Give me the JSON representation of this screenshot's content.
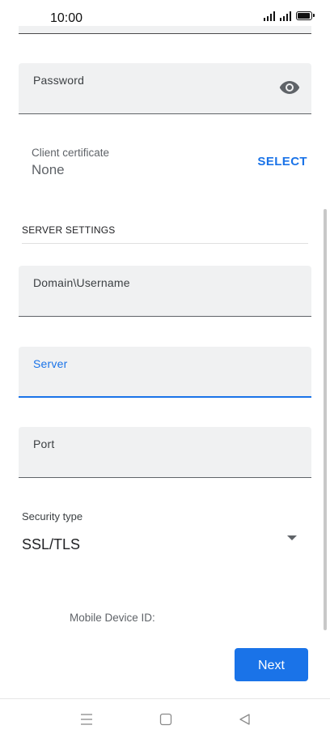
{
  "status_bar": {
    "time": "10:00",
    "icons": [
      "signal-1-icon",
      "signal-2-icon",
      "battery-icon"
    ]
  },
  "form": {
    "password": {
      "label": "Password",
      "value": "",
      "icon": "eye-icon"
    },
    "client_certificate": {
      "label": "Client certificate",
      "value": "None",
      "action_label": "SELECT"
    },
    "server_settings": {
      "header": "SERVER SETTINGS",
      "domain_username": {
        "label": "Domain\\Username",
        "value": ""
      },
      "server": {
        "label": "Server",
        "value": "",
        "focused": true
      },
      "port": {
        "label": "Port",
        "value": ""
      },
      "security_type": {
        "label": "Security type",
        "value": "SSL/TLS",
        "icon": "dropdown-arrow-icon"
      }
    },
    "mobile_device_id": {
      "label": "Mobile Device ID:",
      "value": ""
    },
    "next_label": "Next"
  },
  "nav_bar": {
    "icons": [
      "menu-icon",
      "home-icon",
      "back-icon"
    ]
  },
  "colors": {
    "accent": "#1a73e8",
    "field_background": "#f0f1f2",
    "text_secondary": "#5f6368"
  }
}
